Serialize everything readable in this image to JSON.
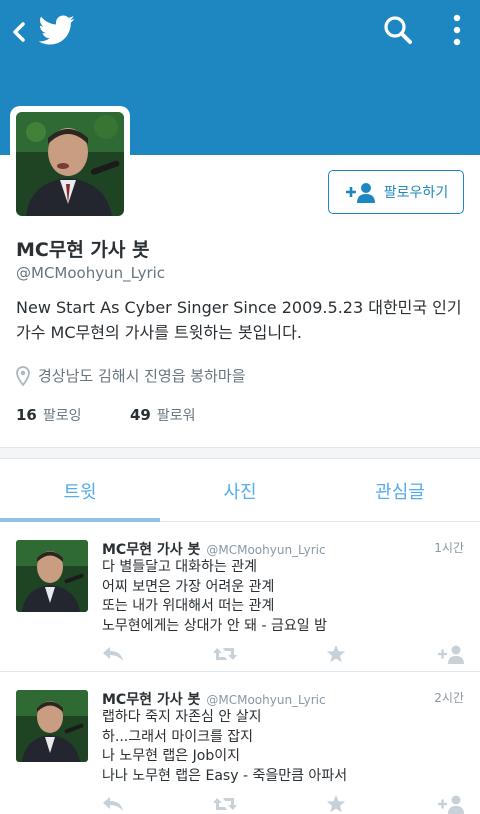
{
  "profile": {
    "name": "MC무현 가사 봇",
    "handle": "@MCMoohyun_Lyric",
    "bio": "New Start As Cyber Singer Since 2009.5.23 대한민국 인기가수 MC무현의 가사를 트윗하는 봇입니다.",
    "location": "경상남도 김해시 진영읍 봉하마을",
    "following_count": "16",
    "following_label": "팔로잉",
    "followers_count": "49",
    "followers_label": "팔로워",
    "follow_button_label": "팔로우하기"
  },
  "tabs": [
    {
      "label": "트윗",
      "active": true
    },
    {
      "label": "사진",
      "active": false
    },
    {
      "label": "관심글",
      "active": false
    }
  ],
  "tweets": [
    {
      "name": "MC무현 가사 봇",
      "handle": "@MCMoohyun_Lyric",
      "time": "1시간",
      "lines": [
        "다 별들달고 대화하는 관계",
        "어찌 보면은 가장 어려운 관계",
        "또는 내가 위대해서 떠는 관계",
        "노무현에게는 상대가 안 돼 - 금요일 밤"
      ]
    },
    {
      "name": "MC무현 가사 봇",
      "handle": "@MCMoohyun_Lyric",
      "time": "2시간",
      "lines": [
        "랩하다 죽지 자존심 안 살지",
        "하...그래서 마이크를 잡지",
        "나 노무현 랩은 Job이지",
        "나나 노무현 랩은 Easy - 죽을만큼 아파서"
      ]
    }
  ],
  "icons": {
    "back": "chevron-left-icon",
    "logo": "twitter-bird-icon",
    "search": "search-icon",
    "menu": "overflow-menu-icon",
    "location": "location-pin-icon",
    "follow": "add-user-icon",
    "reply": "reply-icon",
    "retweet": "retweet-icon",
    "favorite": "star-icon",
    "follow_small": "add-user-icon"
  },
  "colors": {
    "header": "#1e87c1",
    "accent": "#55acee",
    "text": "#292f33",
    "muted": "#66757f",
    "action_icons": "#c8d1d8"
  }
}
